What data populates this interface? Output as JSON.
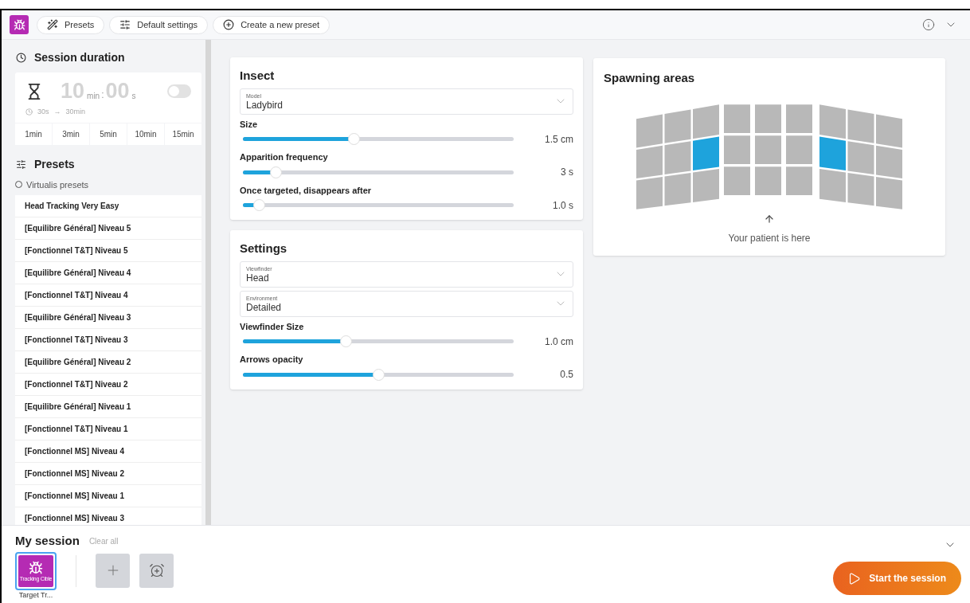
{
  "toolbar": {
    "buttons": [
      {
        "kind": "wand",
        "label": "Presets"
      },
      {
        "kind": "sliders",
        "label": "Default settings"
      },
      {
        "kind": "plus",
        "label": "Create a new preset"
      }
    ]
  },
  "session_duration": {
    "title": "Session duration",
    "minutes": "10",
    "min_unit": "min",
    "separator": ":",
    "seconds": "00",
    "sec_unit": "s",
    "enabled": false,
    "range_from": "30s",
    "range_arrow": "→",
    "range_to": "30min",
    "quick": [
      "1min",
      "3min",
      "5min",
      "10min",
      "15min"
    ]
  },
  "presets": {
    "title": "Presets",
    "source": {
      "label": "Virtualis presets",
      "selected": false
    },
    "items": [
      "Head Tracking Very Easy",
      "[Equilibre Général] Niveau 5",
      "[Fonctionnel T&T] Niveau 5",
      "[Equilibre Général] Niveau 4",
      "[Fonctionnel T&T] Niveau 4",
      "[Equilibre Général] Niveau 3",
      "[Fonctionnel T&T] Niveau 3",
      "[Equilibre Général] Niveau 2",
      "[Fonctionnel T&T] Niveau 2",
      "[Equilibre Général] Niveau 1",
      "[Fonctionnel T&T] Niveau 1",
      "[Fonctionnel MS] Niveau 4",
      "[Fonctionnel MS] Niveau 2",
      "[Fonctionnel MS] Niveau 1",
      "[Fonctionnel MS] Niveau 3"
    ]
  },
  "cards": [
    {
      "title": "Insect",
      "controls": [
        {
          "kind": "select",
          "label": "Model",
          "value": "Ladybird"
        },
        {
          "kind": "slider",
          "label": "Size",
          "level": 0.41,
          "reading": "1.5 cm"
        },
        {
          "kind": "slider",
          "label": "Apparition frequency",
          "level": 0.12,
          "reading": "3 s"
        },
        {
          "kind": "slider",
          "label": "Once targeted, disappears after",
          "level": 0.06,
          "reading": "1.0 s"
        }
      ]
    },
    {
      "title": "Settings",
      "controls": [
        {
          "kind": "select",
          "label": "Viewfinder",
          "value": "Head"
        },
        {
          "kind": "select",
          "label": "Environment",
          "value": "Detailed"
        },
        {
          "kind": "slider",
          "label": "Viewfinder Size",
          "level": 0.38,
          "reading": "1.0 cm"
        },
        {
          "kind": "slider",
          "label": "Arrows opacity",
          "level": 0.5,
          "reading": "0.5"
        }
      ]
    }
  ],
  "spawning_areas": {
    "title": "Spawning areas",
    "caption": "Your patient is here",
    "rows": [
      [
        false,
        false,
        false,
        false,
        false,
        false,
        false,
        false,
        false
      ],
      [
        false,
        false,
        true,
        false,
        false,
        false,
        true,
        false,
        false
      ],
      [
        false,
        false,
        false,
        false,
        false,
        false,
        false,
        false,
        false
      ]
    ]
  },
  "my_session": {
    "title": "My session",
    "clear": "Clear all",
    "items": [
      {
        "caption": "Tracking Cible",
        "label": "Target Tr...",
        "selected": true
      }
    ],
    "start": "Start the session"
  }
}
